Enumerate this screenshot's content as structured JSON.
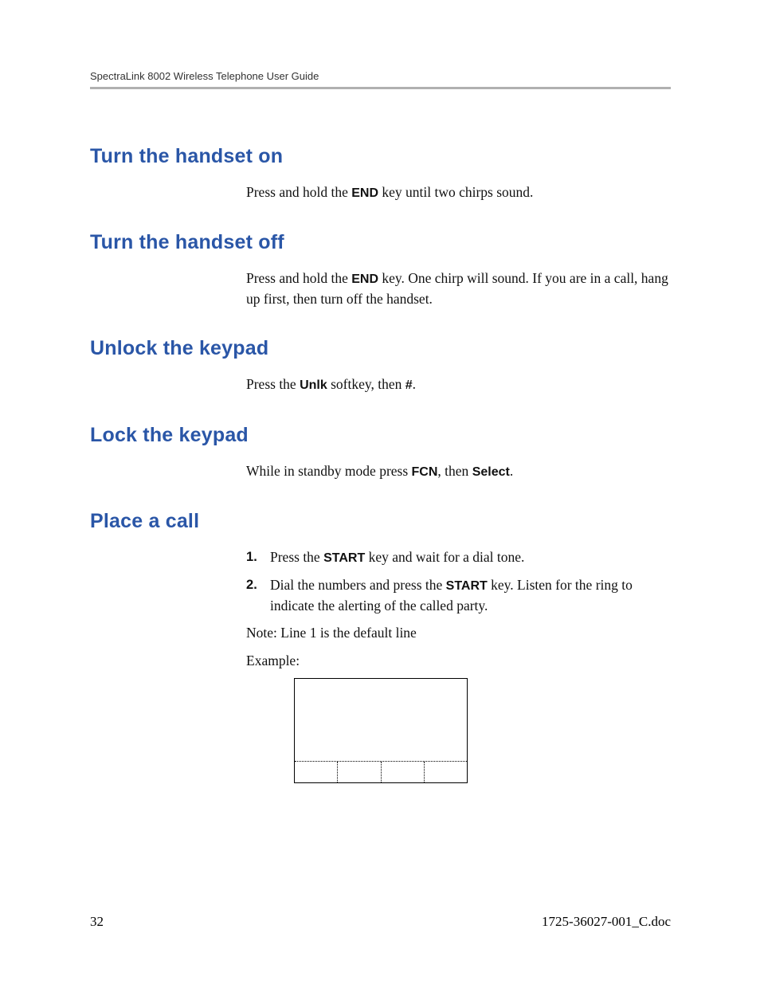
{
  "header": {
    "running_title": "SpectraLink 8002 Wireless Telephone User Guide"
  },
  "sections": {
    "s1": {
      "title": "Turn the handset on",
      "p_a": "Press and hold the ",
      "key": "END",
      "p_b": " key until two chirps sound."
    },
    "s2": {
      "title": "Turn the handset off",
      "p_a": "Press and hold the ",
      "key": "END",
      "p_b": " key. One chirp will sound. If you are in a call, hang up first, then turn off the handset."
    },
    "s3": {
      "title": "Unlock the keypad",
      "p_a": "Press the ",
      "key1": "Unlk",
      "p_b": " softkey, then ",
      "key2": "#",
      "p_c": "."
    },
    "s4": {
      "title": "Lock the keypad",
      "p_a": "While in standby mode press ",
      "key1": "FCN",
      "p_b": ", then ",
      "key2": "Select",
      "p_c": "."
    },
    "s5": {
      "title": "Place a call",
      "step1_a": "Press the ",
      "step1_key": "START",
      "step1_b": " key and wait for a dial tone.",
      "step2_a": "Dial the numbers and press the ",
      "step2_key": "START",
      "step2_b": " key. Listen for the ring to indicate the alerting of the called party.",
      "note": "Note: Line 1 is the default line",
      "example_label": "Example:"
    }
  },
  "footer": {
    "page_number": "32",
    "doc_id": "1725-36027-001_C.doc"
  }
}
